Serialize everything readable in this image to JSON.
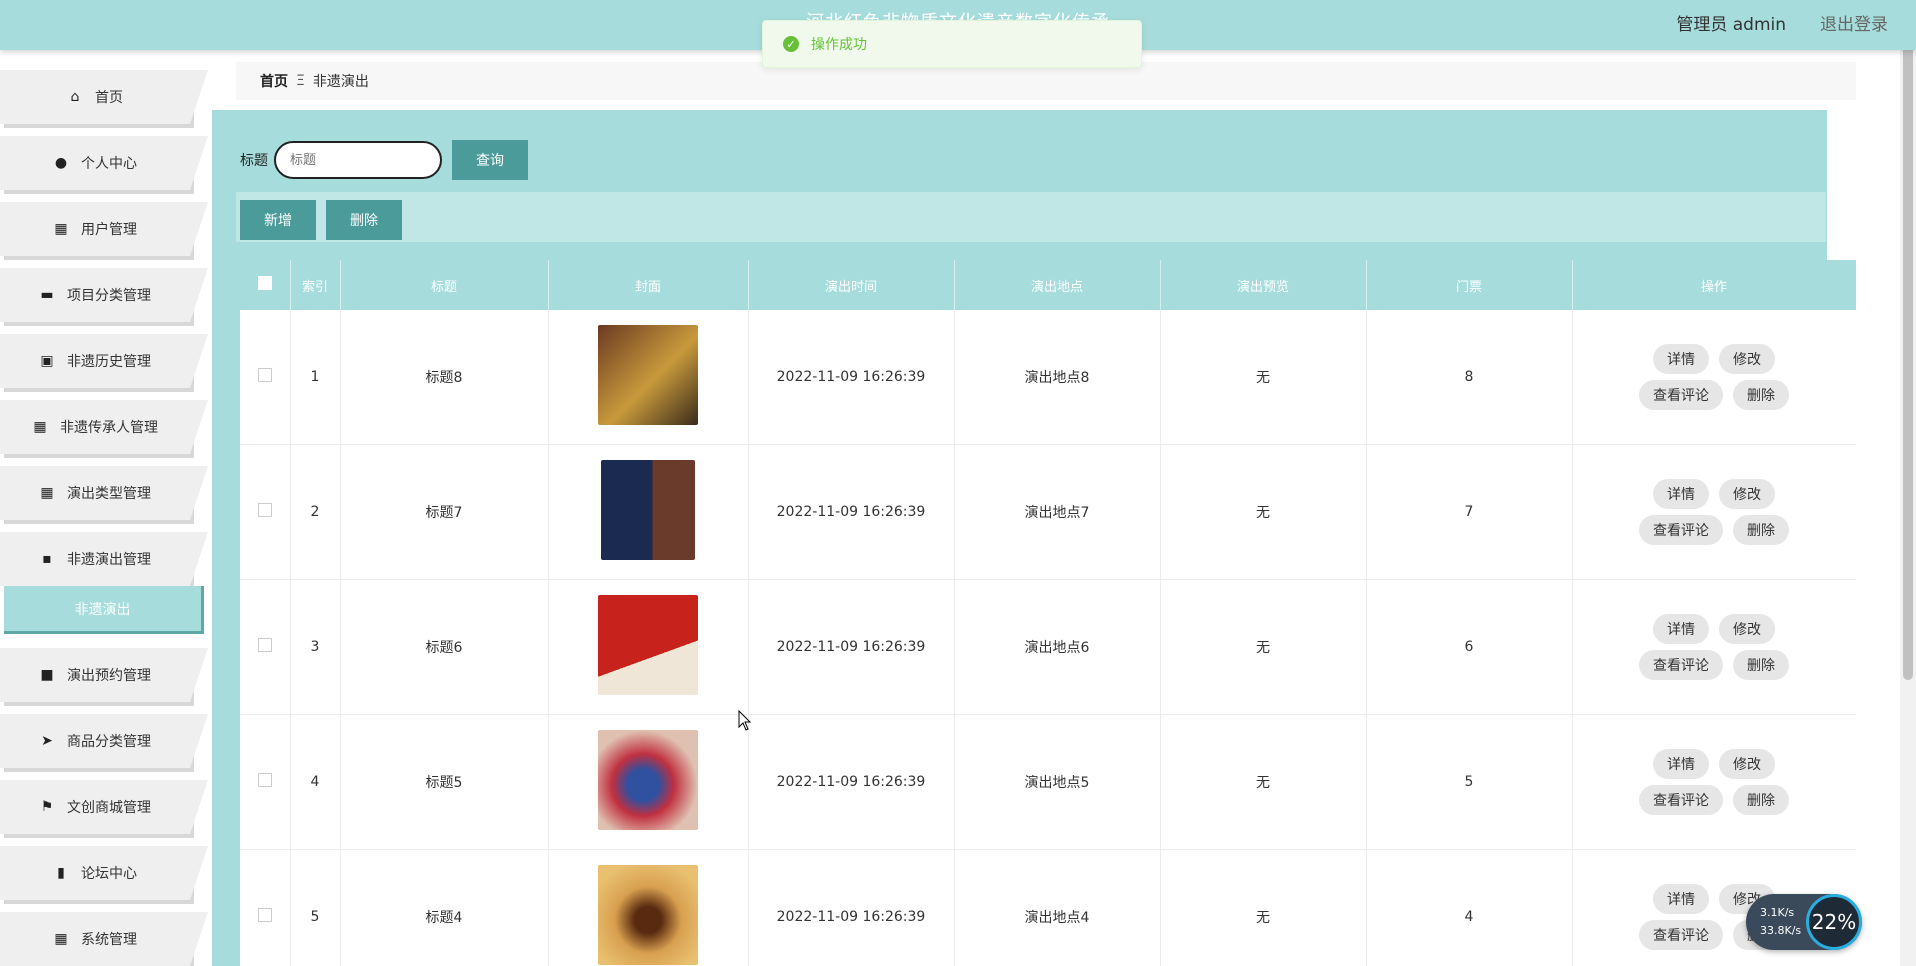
{
  "header": {
    "site_title": "河北红色非物质文化遗产数字化传承",
    "user_label": "管理员 admin",
    "logout_label": "退出登录"
  },
  "toast": {
    "message": "操作成功"
  },
  "sidebar": {
    "items": [
      {
        "label": "首页",
        "icon": "home-icon"
      },
      {
        "label": "个人中心",
        "icon": "user-icon"
      },
      {
        "label": "用户管理",
        "icon": "grid-icon"
      },
      {
        "label": "项目分类管理",
        "icon": "monitor-icon"
      },
      {
        "label": "非遗历史管理",
        "icon": "clipboard-icon"
      },
      {
        "label": "非遗传承人管理",
        "icon": "grid-icon"
      },
      {
        "label": "演出类型管理",
        "icon": "grid-icon"
      },
      {
        "label": "非遗演出管理",
        "icon": "chat-icon"
      },
      {
        "label": "演出预约管理",
        "icon": "video-icon"
      },
      {
        "label": "商品分类管理",
        "icon": "send-icon"
      },
      {
        "label": "文创商城管理",
        "icon": "flag-icon"
      },
      {
        "label": "论坛中心",
        "icon": "bar-chart-icon"
      },
      {
        "label": "系统管理",
        "icon": "grid-icon"
      }
    ],
    "active_sub": "非遗演出"
  },
  "breadcrumb": {
    "home": "首页",
    "sep": "Ξ",
    "current": "非遗演出"
  },
  "search": {
    "label": "标题",
    "placeholder": "标题",
    "button": "查询"
  },
  "actions": {
    "add": "新增",
    "delete": "删除"
  },
  "table": {
    "headers": [
      "索引",
      "标题",
      "封面",
      "演出时间",
      "演出地点",
      "演出预览",
      "门票",
      "操作"
    ],
    "rows": [
      {
        "index": "1",
        "title": "标题8",
        "time": "2022-11-09 16:26:39",
        "place": "演出地点8",
        "preview": "无",
        "ticket": "8"
      },
      {
        "index": "2",
        "title": "标题7",
        "time": "2022-11-09 16:26:39",
        "place": "演出地点7",
        "preview": "无",
        "ticket": "7"
      },
      {
        "index": "3",
        "title": "标题6",
        "time": "2022-11-09 16:26:39",
        "place": "演出地点6",
        "preview": "无",
        "ticket": "6"
      },
      {
        "index": "4",
        "title": "标题5",
        "time": "2022-11-09 16:26:39",
        "place": "演出地点5",
        "preview": "无",
        "ticket": "5"
      },
      {
        "index": "5",
        "title": "标题4",
        "time": "2022-11-09 16:26:39",
        "place": "演出地点4",
        "preview": "无",
        "ticket": "4"
      }
    ],
    "ops": {
      "detail": "详情",
      "edit": "修改",
      "comments": "查看评论",
      "delete": "删除"
    }
  },
  "net_widget": {
    "up": "3.1K/s",
    "down": "33.8K/s",
    "percent": "22%"
  },
  "colors": {
    "accent": "#a6dcdc",
    "button": "#4b9b9b",
    "success": "#67c23a"
  }
}
